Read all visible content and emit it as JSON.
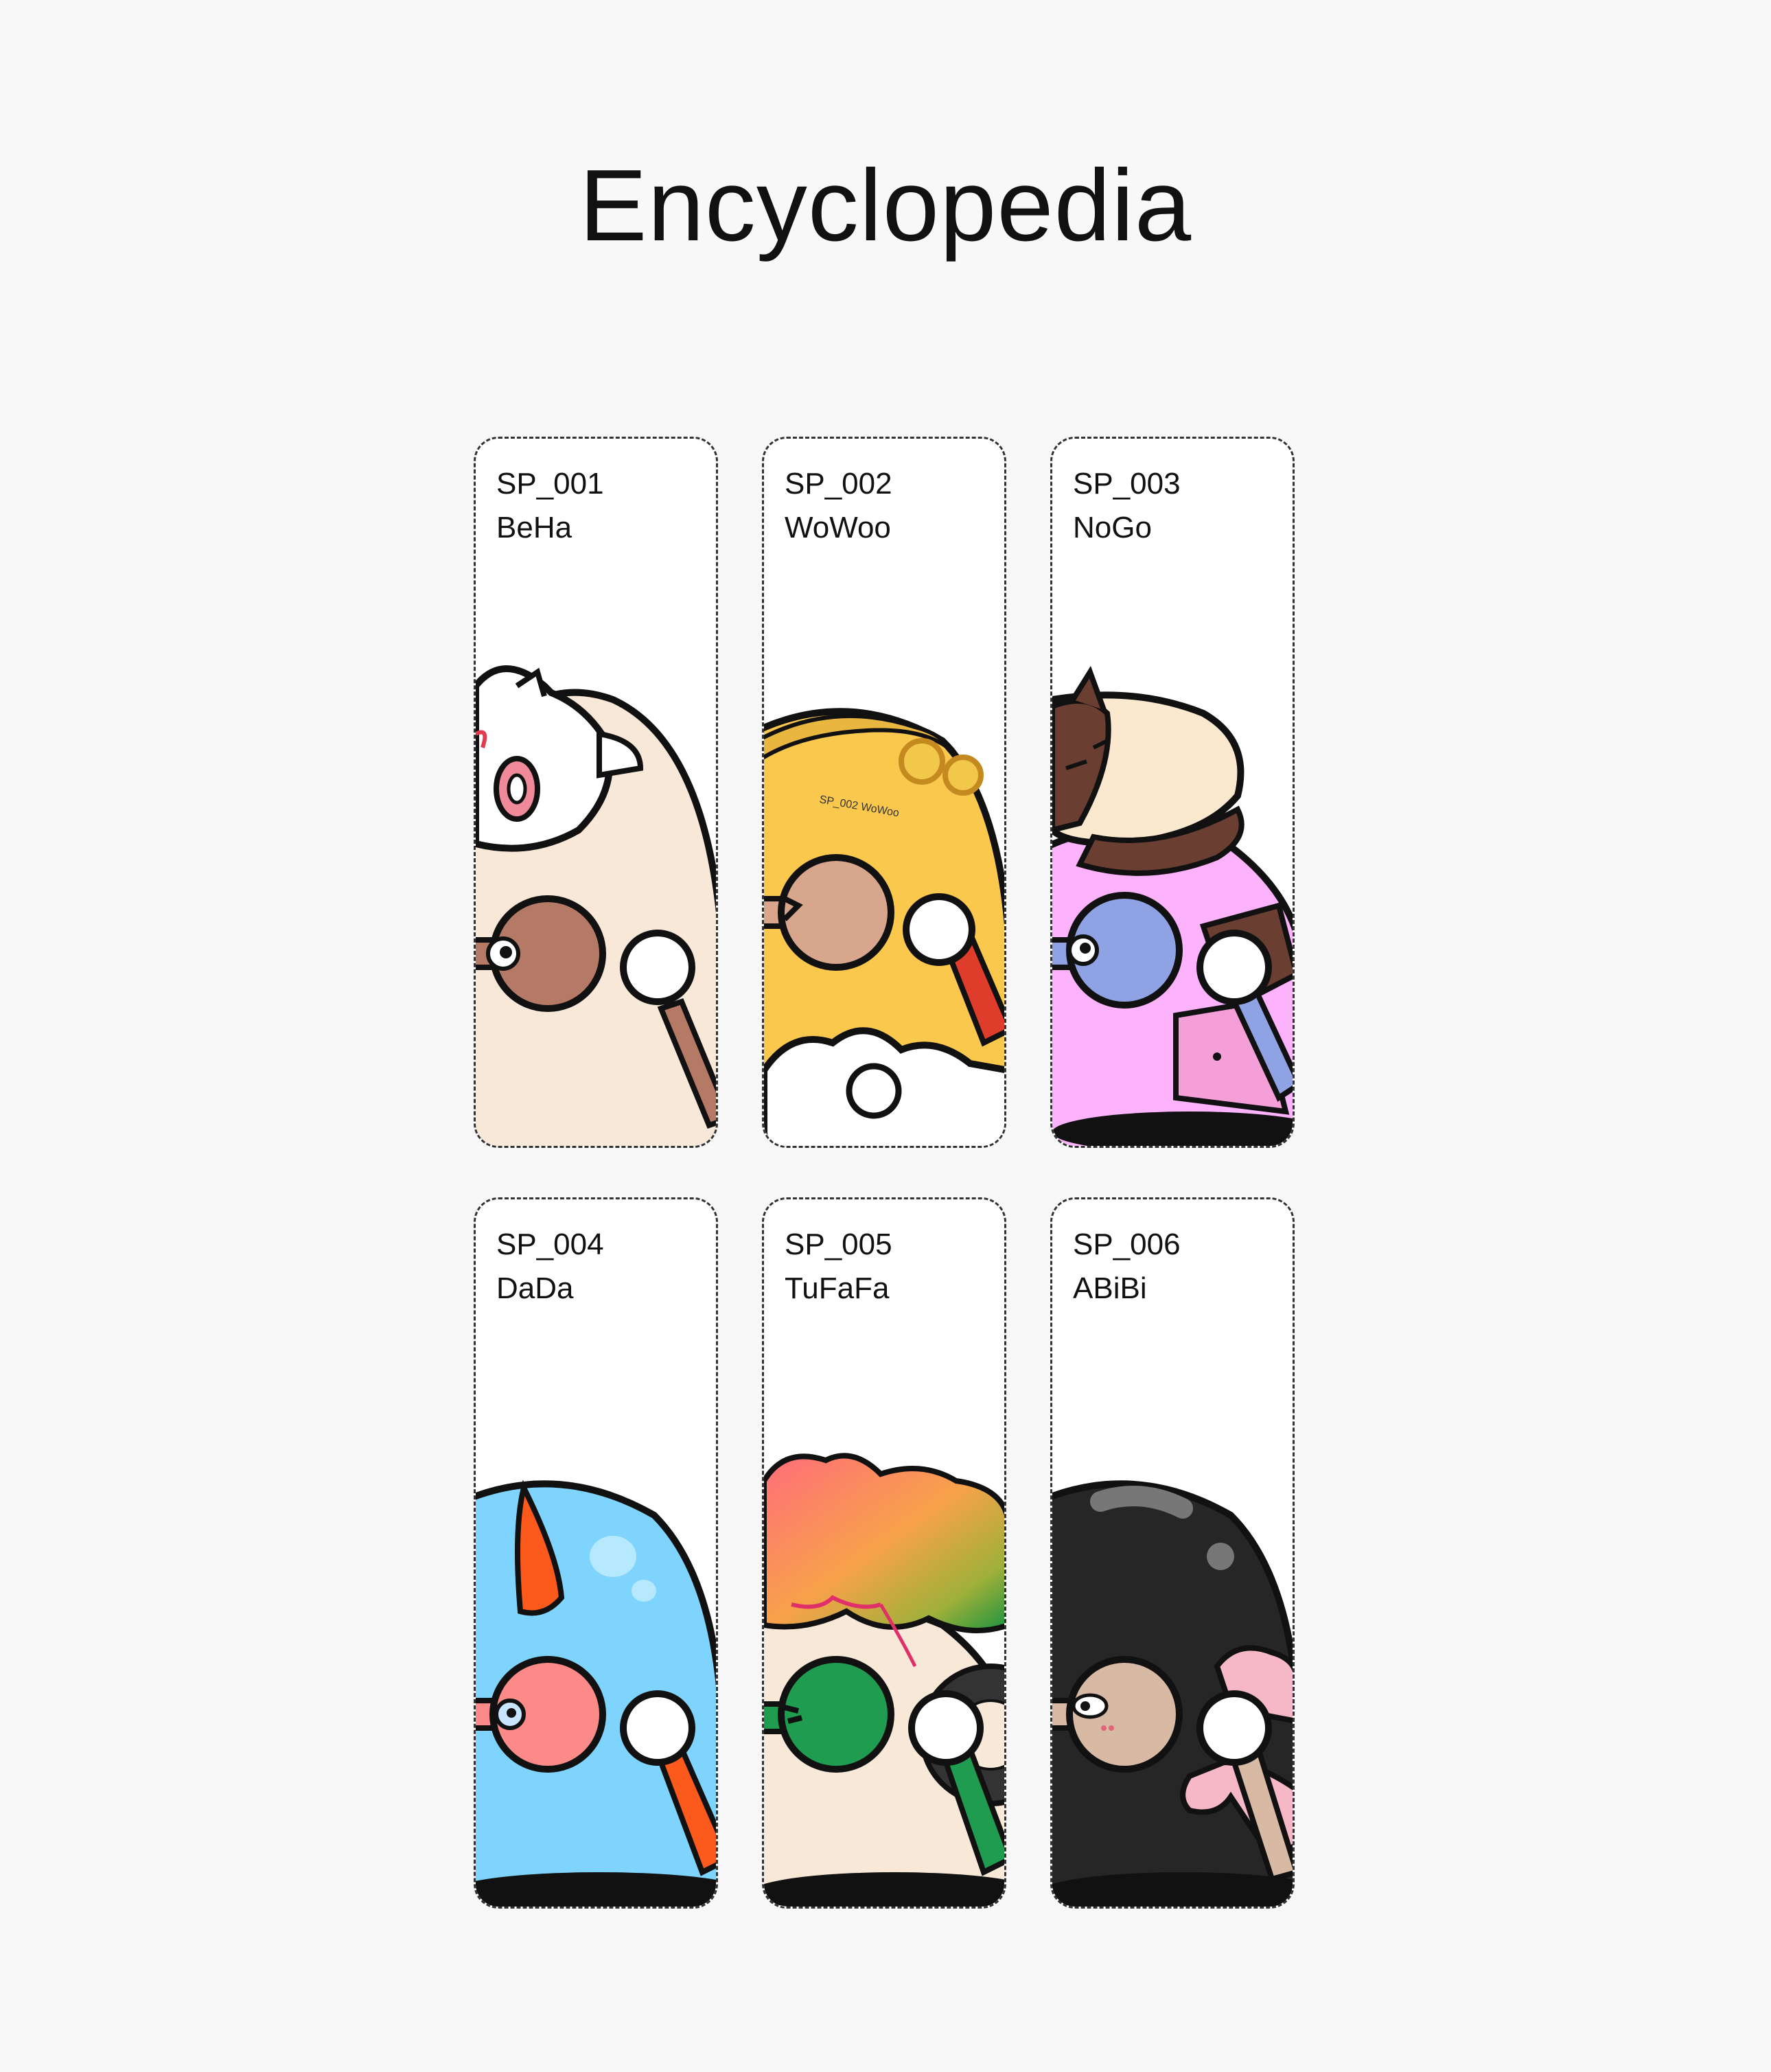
{
  "page": {
    "title": "Encyclopedia"
  },
  "cards": [
    {
      "code": "SP_001",
      "name": "BeHa",
      "colors": {
        "body": "#f7e8d8",
        "eye": "#b57a66",
        "accent": "#b57a66"
      },
      "decoration": "lion-mask-icon"
    },
    {
      "code": "SP_002",
      "name": "WoWoo",
      "colors": {
        "body": "#fbc84e",
        "eye": "#d8a68c",
        "accent": "#d8a68c"
      },
      "decoration": "cloud-crown-icon",
      "inscription": "SP_002 WoWoo"
    },
    {
      "code": "SP_003",
      "name": "NoGo",
      "colors": {
        "body": "#fdb2fc",
        "eye": "#8fa2e3",
        "accent": "#8fa2e3"
      },
      "decoration": "sleeping-cat-icon"
    },
    {
      "code": "SP_004",
      "name": "DaDa",
      "colors": {
        "body": "#7fd4fd",
        "eye": "#fb8a89",
        "accent": "#fb5a1c"
      },
      "decoration": "horn-icon"
    },
    {
      "code": "SP_005",
      "name": "TuFaFa",
      "colors": {
        "body": "#f7e8d8",
        "eye": "#1f9c50",
        "accent": "#1f9c50"
      },
      "decoration": "rainbow-afro-icon"
    },
    {
      "code": "SP_006",
      "name": "ABiBi",
      "colors": {
        "body": "#262626",
        "eye": "#d7b9a4",
        "accent": "#d7b9a4"
      },
      "decoration": "bow-icon"
    }
  ]
}
